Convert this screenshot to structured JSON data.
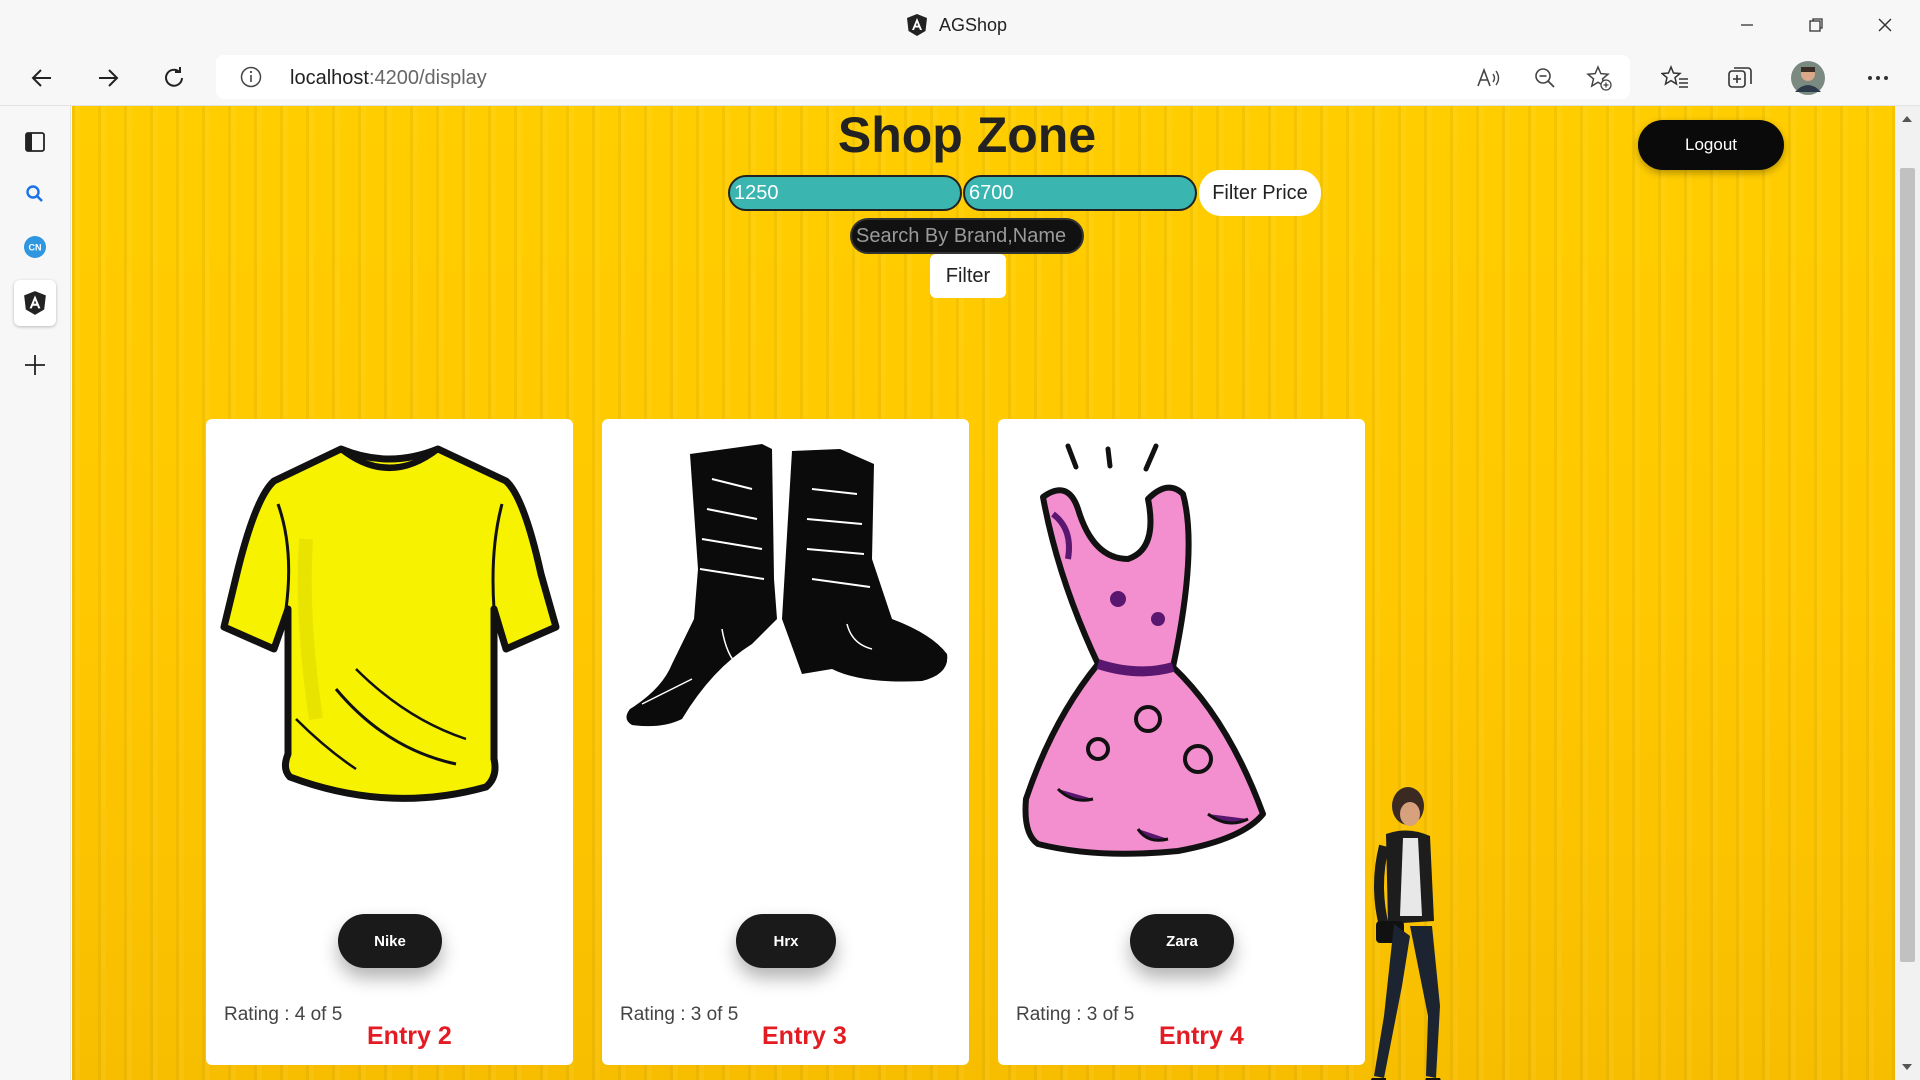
{
  "window": {
    "title": "AGShop"
  },
  "address_bar": {
    "url_host": "localhost",
    "url_rest": ":4200/display"
  },
  "sidebar": {
    "items": [
      "tabs",
      "search",
      "collections",
      "angular-app",
      "add"
    ]
  },
  "page": {
    "title": "Shop Zone",
    "min_price": "1250",
    "max_price": "6700",
    "filter_price_label": "Filter Price",
    "search_placeholder": "Search By Brand,Name",
    "filter_label": "Filter",
    "logout_label": "Logout"
  },
  "products": [
    {
      "brand": "Nike",
      "rating": "Rating : 4 of 5",
      "entry": "Entry 2",
      "image": "yellow-tshirt"
    },
    {
      "brand": "Hrx",
      "rating": "Rating : 3 of 5",
      "entry": "Entry 3",
      "image": "black-boots"
    },
    {
      "brand": "Zara",
      "rating": "Rating : 3 of 5",
      "entry": "Entry 4",
      "image": "pink-dress"
    }
  ],
  "colors": {
    "background": "#ffc800",
    "price_input": "#3ab5b0",
    "entry_text": "#e31b23",
    "brand_button": "#1a1a1a"
  }
}
